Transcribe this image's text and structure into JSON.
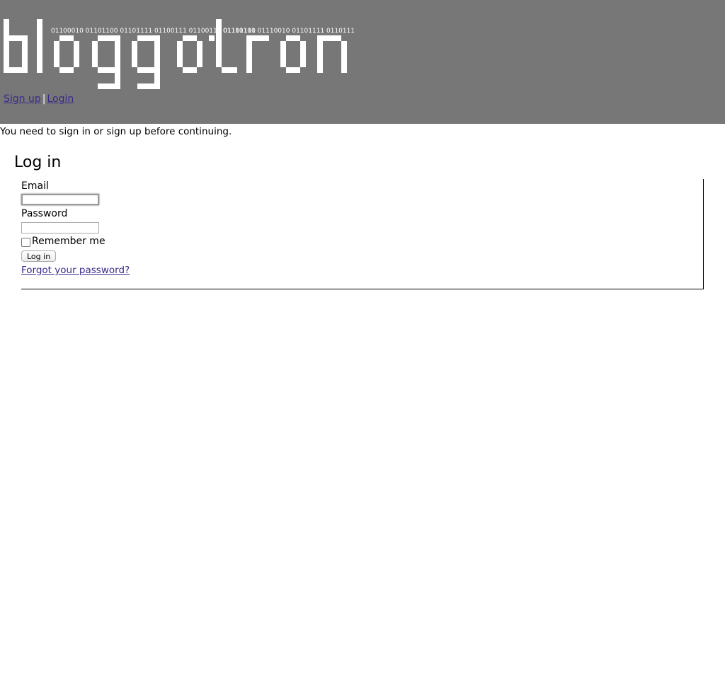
{
  "header": {
    "logo_text": "bloggotron",
    "binary_tagline_1": "01100010 01101100 01101111 01100111 01100111 01101111",
    "binary_tagline_2": "01110100 01110010 01101111 01101110",
    "bg_color": "#777777",
    "nav": {
      "signup_label": "Sign up",
      "separator": "|",
      "login_label": "Login"
    }
  },
  "flash": {
    "message": "You need to sign in or sign up before continuing."
  },
  "login_form": {
    "title": "Log in",
    "email_label": "Email",
    "email_value": "",
    "password_label": "Password",
    "password_value": "",
    "remember_label": "Remember me",
    "remember_checked": false,
    "submit_label": "Log in",
    "forgot_label": "Forgot your password?"
  }
}
